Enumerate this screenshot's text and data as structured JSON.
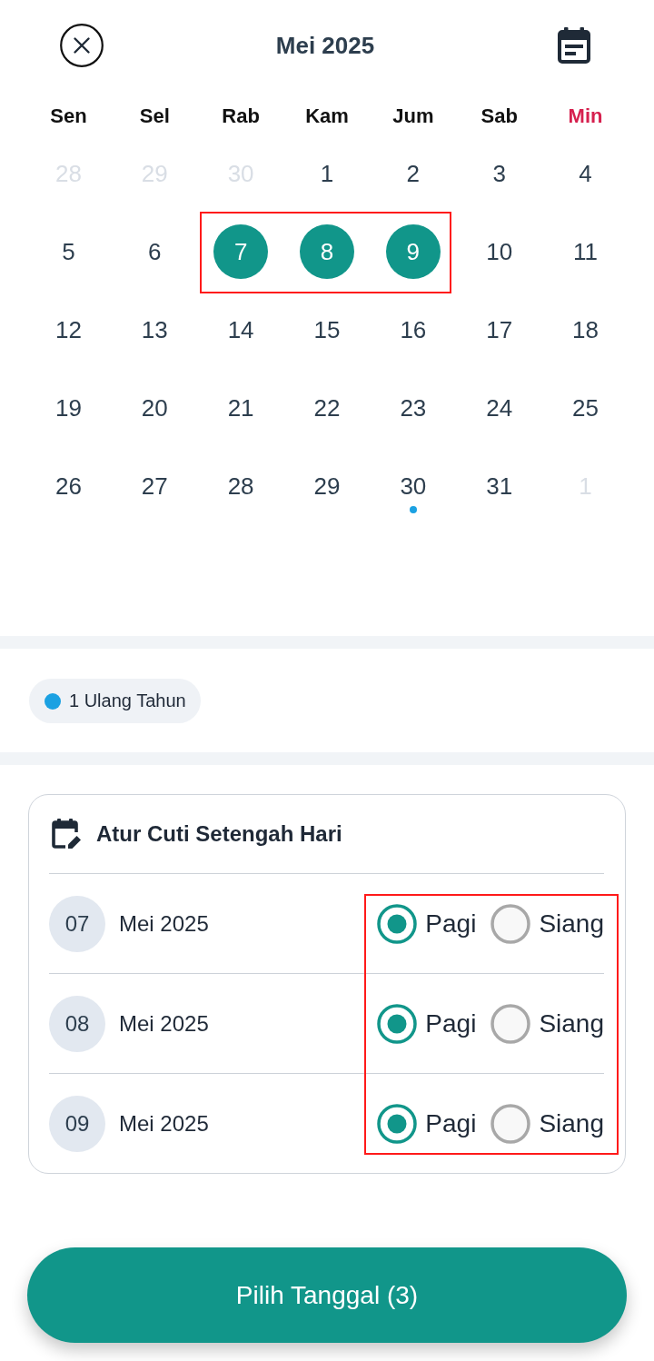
{
  "header": {
    "title": "Mei 2025"
  },
  "calendar": {
    "highlight_selection": true,
    "weekdays": [
      {
        "label": "Sen",
        "kind": "weekday"
      },
      {
        "label": "Sel",
        "kind": "weekday"
      },
      {
        "label": "Rab",
        "kind": "weekday"
      },
      {
        "label": "Kam",
        "kind": "weekday"
      },
      {
        "label": "Jum",
        "kind": "weekday"
      },
      {
        "label": "Sab",
        "kind": "weekday"
      },
      {
        "label": "Min",
        "kind": "sunday"
      }
    ],
    "weeks": [
      [
        {
          "label": "28",
          "outside": true,
          "selected": false,
          "event": false
        },
        {
          "label": "29",
          "outside": true,
          "selected": false,
          "event": false
        },
        {
          "label": "30",
          "outside": true,
          "selected": false,
          "event": false
        },
        {
          "label": "1",
          "outside": false,
          "selected": false,
          "event": false
        },
        {
          "label": "2",
          "outside": false,
          "selected": false,
          "event": false
        },
        {
          "label": "3",
          "outside": false,
          "selected": false,
          "event": false
        },
        {
          "label": "4",
          "outside": false,
          "selected": false,
          "event": false
        }
      ],
      [
        {
          "label": "5",
          "outside": false,
          "selected": false,
          "event": false
        },
        {
          "label": "6",
          "outside": false,
          "selected": false,
          "event": false
        },
        {
          "label": "7",
          "outside": false,
          "selected": true,
          "event": false
        },
        {
          "label": "8",
          "outside": false,
          "selected": true,
          "event": false
        },
        {
          "label": "9",
          "outside": false,
          "selected": true,
          "event": false
        },
        {
          "label": "10",
          "outside": false,
          "selected": false,
          "event": false
        },
        {
          "label": "11",
          "outside": false,
          "selected": false,
          "event": false
        }
      ],
      [
        {
          "label": "12",
          "outside": false,
          "selected": false,
          "event": false
        },
        {
          "label": "13",
          "outside": false,
          "selected": false,
          "event": false
        },
        {
          "label": "14",
          "outside": false,
          "selected": false,
          "event": false
        },
        {
          "label": "15",
          "outside": false,
          "selected": false,
          "event": false
        },
        {
          "label": "16",
          "outside": false,
          "selected": false,
          "event": false
        },
        {
          "label": "17",
          "outside": false,
          "selected": false,
          "event": false
        },
        {
          "label": "18",
          "outside": false,
          "selected": false,
          "event": false
        }
      ],
      [
        {
          "label": "19",
          "outside": false,
          "selected": false,
          "event": false
        },
        {
          "label": "20",
          "outside": false,
          "selected": false,
          "event": false
        },
        {
          "label": "21",
          "outside": false,
          "selected": false,
          "event": false
        },
        {
          "label": "22",
          "outside": false,
          "selected": false,
          "event": false
        },
        {
          "label": "23",
          "outside": false,
          "selected": false,
          "event": false
        },
        {
          "label": "24",
          "outside": false,
          "selected": false,
          "event": false
        },
        {
          "label": "25",
          "outside": false,
          "selected": false,
          "event": false
        }
      ],
      [
        {
          "label": "26",
          "outside": false,
          "selected": false,
          "event": false
        },
        {
          "label": "27",
          "outside": false,
          "selected": false,
          "event": false
        },
        {
          "label": "28",
          "outside": false,
          "selected": false,
          "event": false
        },
        {
          "label": "29",
          "outside": false,
          "selected": false,
          "event": false
        },
        {
          "label": "30",
          "outside": false,
          "selected": false,
          "event": true
        },
        {
          "label": "31",
          "outside": false,
          "selected": false,
          "event": false
        },
        {
          "label": "1",
          "outside": true,
          "selected": false,
          "event": false
        }
      ]
    ]
  },
  "legend": {
    "label": "1 Ulang Tahun"
  },
  "half_day": {
    "title": "Atur Cuti Setengah Hari",
    "highlight_options": true,
    "rows": [
      {
        "day": "07",
        "month": "Mei 2025",
        "options": [
          {
            "label": "Pagi",
            "selected": true
          },
          {
            "label": "Siang",
            "selected": false
          }
        ]
      },
      {
        "day": "08",
        "month": "Mei 2025",
        "options": [
          {
            "label": "Pagi",
            "selected": true
          },
          {
            "label": "Siang",
            "selected": false
          }
        ]
      },
      {
        "day": "09",
        "month": "Mei 2025",
        "options": [
          {
            "label": "Pagi",
            "selected": true
          },
          {
            "label": "Siang",
            "selected": false
          }
        ]
      }
    ]
  },
  "button": {
    "label": "Pilih Tanggal (3)"
  }
}
